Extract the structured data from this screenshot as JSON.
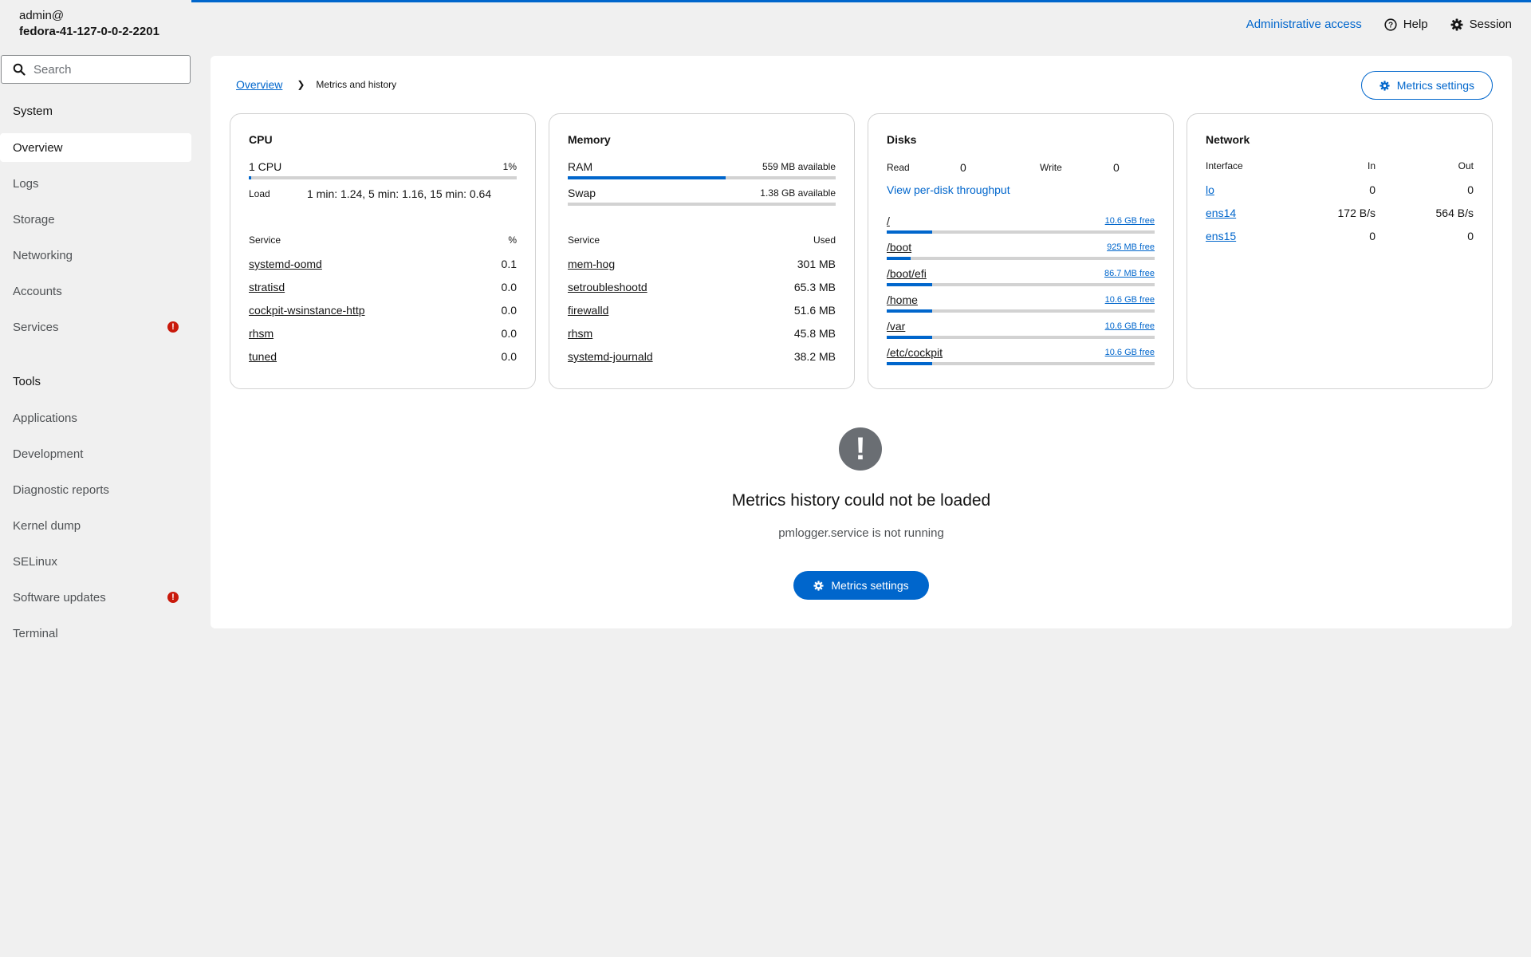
{
  "host": {
    "user": "admin@",
    "name": "fedora-41-127-0-0-2-2201"
  },
  "search": {
    "placeholder": "Search"
  },
  "sidebar": {
    "system_heading": "System",
    "system_items": [
      {
        "label": "Overview",
        "active": true
      },
      {
        "label": "Logs"
      },
      {
        "label": "Storage"
      },
      {
        "label": "Networking"
      },
      {
        "label": "Accounts"
      },
      {
        "label": "Services",
        "badge": "!"
      }
    ],
    "tools_heading": "Tools",
    "tools_items": [
      {
        "label": "Applications"
      },
      {
        "label": "Development"
      },
      {
        "label": "Diagnostic reports"
      },
      {
        "label": "Kernel dump"
      },
      {
        "label": "SELinux"
      },
      {
        "label": "Software updates",
        "badge": "!"
      },
      {
        "label": "Terminal"
      }
    ]
  },
  "topnav": {
    "admin": "Administrative access",
    "help": "Help",
    "session": "Session"
  },
  "breadcrumb": {
    "parent": "Overview",
    "current": "Metrics and history"
  },
  "metrics_settings_label": "Metrics settings",
  "cpu": {
    "title": "CPU",
    "count_label": "1 CPU",
    "usage_label": "1%",
    "usage_fraction": 0.01,
    "load_label": "Load",
    "load_value": "1 min: 1.24, 5 min: 1.16, 15 min: 0.64",
    "col_service": "Service",
    "col_value": "%",
    "services": [
      {
        "name": "systemd-oomd",
        "value": "0.1"
      },
      {
        "name": "stratisd",
        "value": "0.0"
      },
      {
        "name": "cockpit-wsinstance-http",
        "value": "0.0"
      },
      {
        "name": "rhsm",
        "value": "0.0"
      },
      {
        "name": "tuned",
        "value": "0.0"
      }
    ]
  },
  "memory": {
    "title": "Memory",
    "ram_label": "RAM",
    "ram_available": "559 MB available",
    "ram_used_fraction": 0.59,
    "swap_label": "Swap",
    "swap_available": "1.38 GB available",
    "swap_used_fraction": 0,
    "col_service": "Service",
    "col_value": "Used",
    "services": [
      {
        "name": "mem-hog",
        "value": "301 MB"
      },
      {
        "name": "setroubleshootd",
        "value": "65.3 MB"
      },
      {
        "name": "firewalld",
        "value": "51.6 MB"
      },
      {
        "name": "rhsm",
        "value": "45.8 MB"
      },
      {
        "name": "systemd-journald",
        "value": "38.2 MB"
      }
    ]
  },
  "disks": {
    "title": "Disks",
    "read_label": "Read",
    "read_value": "0",
    "write_label": "Write",
    "write_value": "0",
    "per_disk_link": "View per-disk throughput",
    "mounts": [
      {
        "path": "/",
        "free": "10.6 GB free",
        "used_fraction": 0.17
      },
      {
        "path": "/boot",
        "free": "925 MB free",
        "used_fraction": 0.09
      },
      {
        "path": "/boot/efi",
        "free": "86.7 MB free",
        "used_fraction": 0.17
      },
      {
        "path": "/home",
        "free": "10.6 GB free",
        "used_fraction": 0.17
      },
      {
        "path": "/var",
        "free": "10.6 GB free",
        "used_fraction": 0.17
      },
      {
        "path": "/etc/cockpit",
        "free": "10.6 GB free",
        "used_fraction": 0.17
      }
    ]
  },
  "network": {
    "title": "Network",
    "col_interface": "Interface",
    "col_in": "In",
    "col_out": "Out",
    "interfaces": [
      {
        "name": "lo",
        "in": "0",
        "out": "0"
      },
      {
        "name": "ens14",
        "in": "172 B/s",
        "out": "564 B/s"
      },
      {
        "name": "ens15",
        "in": "0",
        "out": "0"
      }
    ]
  },
  "empty_state": {
    "icon": "exclamation-icon",
    "title": "Metrics history could not be loaded",
    "subtitle": "pmlogger.service is not running",
    "button": "Metrics settings"
  },
  "colors": {
    "accent": "#0066cc",
    "danger": "#c9190b"
  }
}
